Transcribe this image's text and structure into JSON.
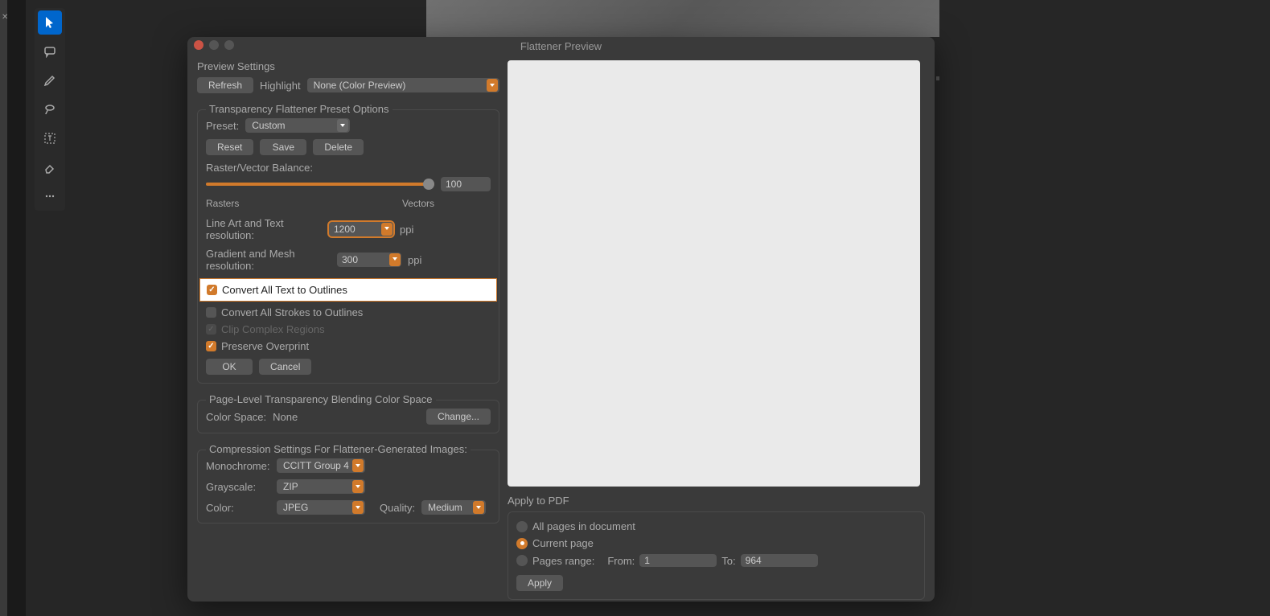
{
  "dialog": {
    "title": "Flattener Preview"
  },
  "preview_settings": {
    "label": "Preview Settings",
    "refresh": "Refresh",
    "highlight_label": "Highlight",
    "highlight_value": "None (Color Preview)"
  },
  "flattener_options": {
    "label": "Transparency Flattener Preset Options",
    "preset_label": "Preset:",
    "preset_value": "Custom",
    "reset": "Reset",
    "save": "Save",
    "delete": "Delete",
    "balance_label": "Raster/Vector Balance:",
    "balance_value": "100",
    "rasters_label": "Rasters",
    "vectors_label": "Vectors",
    "line_art_label": "Line Art and Text resolution:",
    "line_art_value": "1200",
    "line_art_unit": "ppi",
    "gradient_label": "Gradient and Mesh resolution:",
    "gradient_value": "300",
    "gradient_unit": "ppi",
    "convert_text": "Convert All Text to Outlines",
    "convert_strokes": "Convert All Strokes to Outlines",
    "clip_complex": "Clip Complex Regions",
    "preserve_overprint": "Preserve Overprint",
    "ok": "OK",
    "cancel": "Cancel"
  },
  "blending": {
    "label": "Page-Level Transparency Blending Color Space",
    "color_space_label": "Color Space:",
    "color_space_value": "None",
    "change": "Change..."
  },
  "compression": {
    "label": "Compression Settings For Flattener-Generated Images:",
    "monochrome_label": "Monochrome:",
    "monochrome_value": "CCITT Group 4",
    "grayscale_label": "Grayscale:",
    "grayscale_value": "ZIP",
    "color_label": "Color:",
    "color_value": "JPEG",
    "quality_label": "Quality:",
    "quality_value": "Medium"
  },
  "apply_to_pdf": {
    "label": "Apply to PDF",
    "all_pages": "All pages in document",
    "current_page": "Current page",
    "pages_range": "Pages range:",
    "from_label": "From:",
    "from_value": "1",
    "to_label": "To:",
    "to_value": "964",
    "apply": "Apply"
  }
}
